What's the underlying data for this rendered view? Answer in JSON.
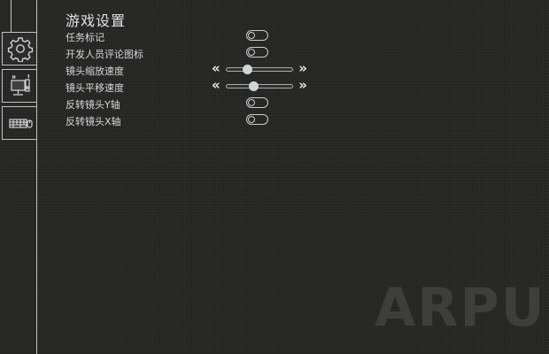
{
  "rail": {
    "tabs": [
      {
        "icon": "gear-icon",
        "active": true
      },
      {
        "icon": "monitor-speaker-icon",
        "active": false
      },
      {
        "icon": "keyboard-mouse-icon",
        "active": false
      }
    ]
  },
  "page": {
    "title": "游戏设置"
  },
  "settings": [
    {
      "label": "任务标记",
      "control": "toggle",
      "on": false
    },
    {
      "label": "开发人员评论图标",
      "control": "toggle",
      "on": false
    },
    {
      "label": "镜头缩放速度",
      "control": "slider",
      "value": 0.32
    },
    {
      "label": "镜头平移速度",
      "control": "slider",
      "value": 0.41
    },
    {
      "label": "反转镜头Y轴",
      "control": "toggle",
      "on": false
    },
    {
      "label": "反转镜头X轴",
      "control": "toggle",
      "on": false
    }
  ],
  "watermark": {
    "text": "ARPUN"
  },
  "colors": {
    "background": "#272725",
    "line": "#bfc3c2",
    "text": "#d4d8d7",
    "thumb": "#cfd6d6"
  }
}
